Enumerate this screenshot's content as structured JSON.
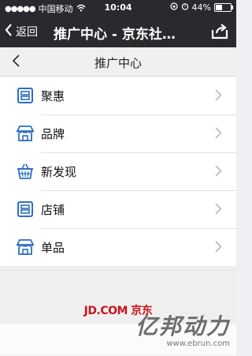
{
  "status_bar": {
    "carrier": "中国移动",
    "time": "10:04",
    "battery": "44%",
    "battery_level": 0.44
  },
  "nav": {
    "back_label": "返回",
    "title": "推广中心 - 京东社…"
  },
  "subheader": {
    "title": "推广中心"
  },
  "list": {
    "items": [
      {
        "label": "聚惠",
        "icon": "store-board-icon"
      },
      {
        "label": "品牌",
        "icon": "storefront-icon"
      },
      {
        "label": "新发现",
        "icon": "basket-icon"
      },
      {
        "label": "店铺",
        "icon": "store-board-icon"
      },
      {
        "label": "单品",
        "icon": "storefront-icon"
      }
    ]
  },
  "footer": {
    "logo": "JD.COM 京东"
  },
  "watermark": {
    "text": "亿邦动力",
    "url": "www.ebrun.com"
  },
  "colors": {
    "nav_bg": "#2a2a2e",
    "icon_blue": "#2f6fbf",
    "jd_red": "#c9151e"
  }
}
